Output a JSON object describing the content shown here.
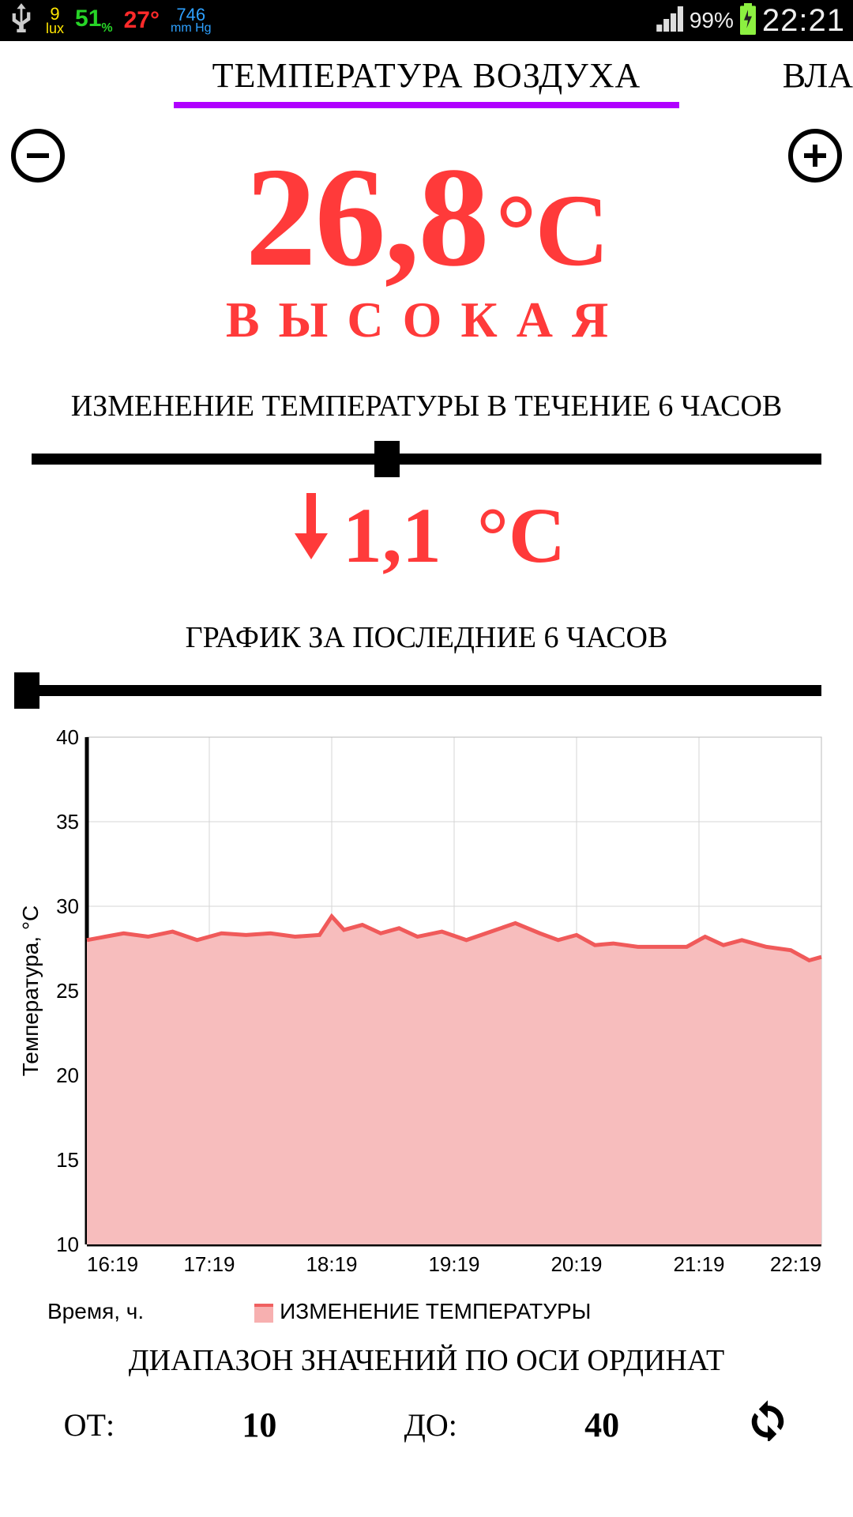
{
  "statusbar": {
    "lux": "9",
    "lux_unit": "lux",
    "humidity": "51",
    "humidity_unit": "%",
    "temp": "27",
    "temp_unit": "°",
    "pressure": "746",
    "pressure_unit": "mm Hg",
    "battery": "99%",
    "time": "22:21"
  },
  "tabs": {
    "active": "ТЕМПЕРАТУРА ВОЗДУХА",
    "next_partial": "ВЛА"
  },
  "main": {
    "value": "26,8",
    "unit": "°C",
    "rating": "ВЫСОКАЯ"
  },
  "change": {
    "title": "ИЗМЕНЕНИЕ ТЕМПЕРАТУРЫ В ТЕЧЕНИЕ 6 ЧАСОВ",
    "slider_pos_pct": 45,
    "direction": "down",
    "delta_value": "1,1",
    "delta_unit": "°C"
  },
  "chart_section": {
    "title": "ГРАФИК ЗА ПОСЛЕДНИЕ 6 ЧАСОВ",
    "slider_pos_pct": 0,
    "xlabel": "Время, ч.",
    "legend": "ИЗМЕНЕНИЕ ТЕМПЕРАТУРЫ"
  },
  "range": {
    "title": "ДИАПАЗОН ЗНАЧЕНИЙ ПО ОСИ ОРДИНАТ",
    "from_label": "ОТ:",
    "from": "10",
    "to_label": "ДО:",
    "to": "40"
  },
  "chart_data": {
    "type": "area",
    "title": "",
    "xlabel": "Время, ч.",
    "ylabel": "Температура, °C",
    "ylim": [
      10,
      40
    ],
    "x_ticks": [
      "16:19",
      "17:19",
      "18:19",
      "19:19",
      "20:19",
      "21:19",
      "22:19"
    ],
    "y_ticks": [
      10,
      15,
      20,
      25,
      30,
      35,
      40
    ],
    "series": [
      {
        "name": "ИЗМЕНЕНИЕ ТЕМПЕРАТУРЫ",
        "x": [
          0,
          0.15,
          0.3,
          0.5,
          0.7,
          0.9,
          1.1,
          1.3,
          1.5,
          1.7,
          1.9,
          2.0,
          2.1,
          2.25,
          2.4,
          2.55,
          2.7,
          2.9,
          3.1,
          3.3,
          3.5,
          3.7,
          3.85,
          4.0,
          4.15,
          4.3,
          4.5,
          4.7,
          4.9,
          5.05,
          5.2,
          5.35,
          5.55,
          5.75,
          5.9,
          6.0
        ],
        "values": [
          28.0,
          28.2,
          28.4,
          28.2,
          28.5,
          28.0,
          28.4,
          28.3,
          28.4,
          28.2,
          28.3,
          29.4,
          28.6,
          28.9,
          28.4,
          28.7,
          28.2,
          28.5,
          28.0,
          28.5,
          29.0,
          28.4,
          28.0,
          28.3,
          27.7,
          27.8,
          27.6,
          27.6,
          27.6,
          28.2,
          27.7,
          28.0,
          27.6,
          27.4,
          26.8,
          27.0
        ]
      }
    ]
  }
}
